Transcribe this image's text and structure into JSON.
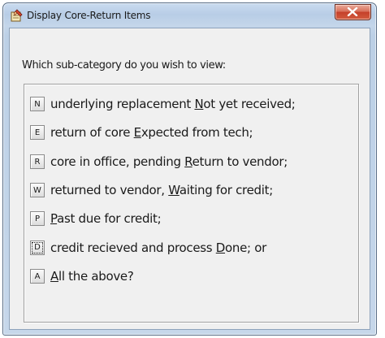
{
  "window": {
    "title": "Display Core-Return Items",
    "app_icon": "pencil-notepad-icon",
    "close_icon": "close-x-icon"
  },
  "prompt": "Which sub-category do you wish to view:",
  "options": [
    {
      "key": "N",
      "before": "underlying replacement ",
      "hotkey": "N",
      "after": "ot yet received;",
      "focused": false
    },
    {
      "key": "E",
      "before": "return of core ",
      "hotkey": "E",
      "after": "xpected from tech;",
      "focused": false
    },
    {
      "key": "R",
      "before": "core in office, pending ",
      "hotkey": "R",
      "after": "eturn to vendor;",
      "focused": false
    },
    {
      "key": "W",
      "before": "returned to vendor, ",
      "hotkey": "W",
      "after": "aiting for credit;",
      "focused": false
    },
    {
      "key": "P",
      "before": "",
      "hotkey": "P",
      "after": "ast due for credit;",
      "focused": false
    },
    {
      "key": "D",
      "before": "credit recieved and process ",
      "hotkey": "D",
      "after": "one; or",
      "focused": true
    },
    {
      "key": "A",
      "before": "",
      "hotkey": "A",
      "after": "ll the above?",
      "focused": false
    }
  ],
  "colors": {
    "frame": "#bcd0e6",
    "client_bg": "#f0f0f0",
    "close_red": "#c5402a"
  }
}
